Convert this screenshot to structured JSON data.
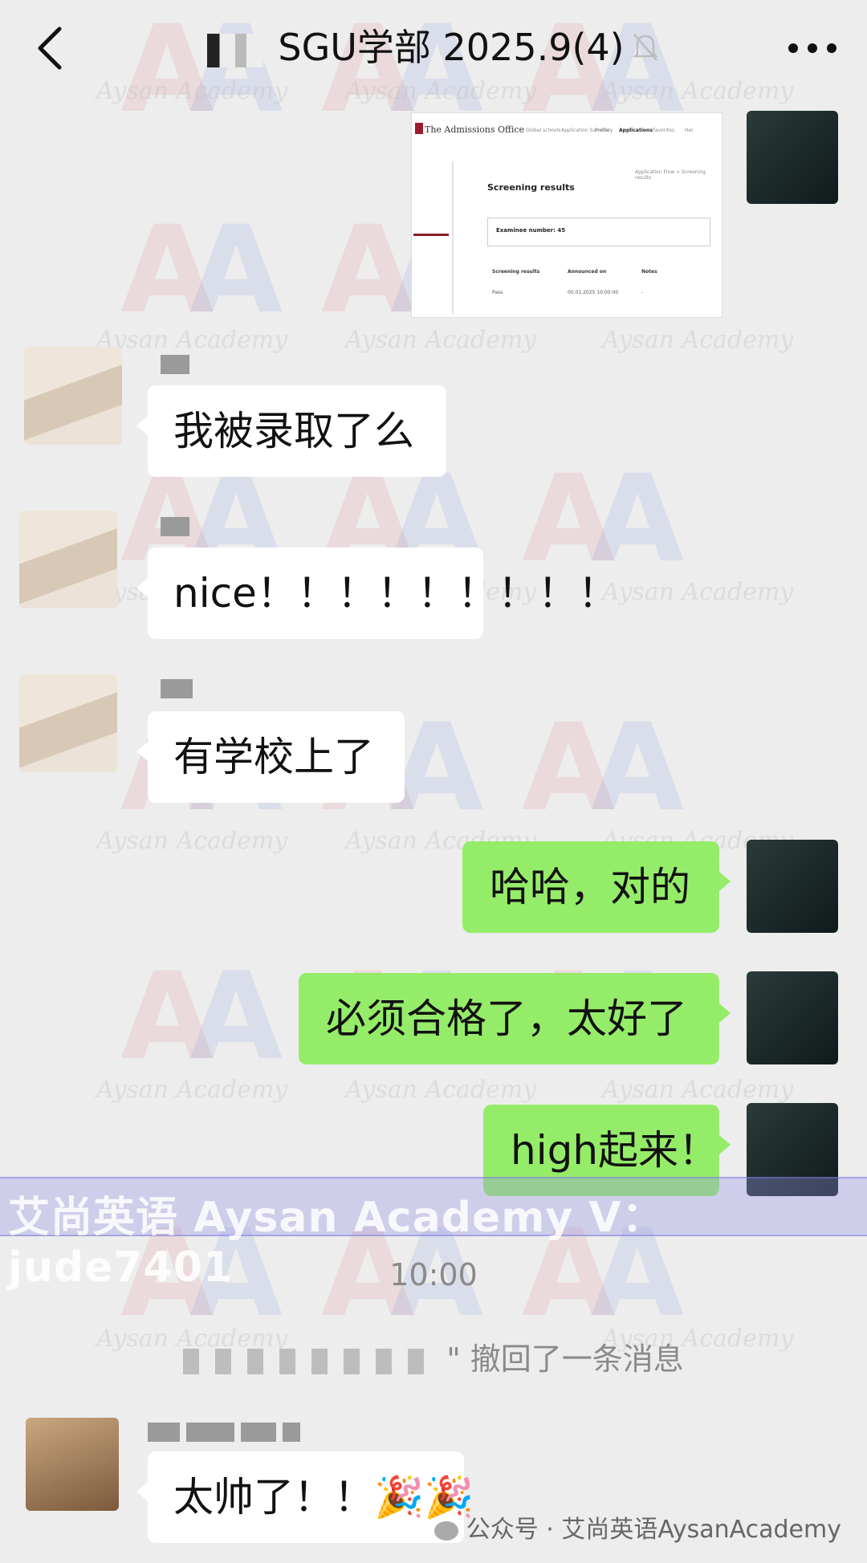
{
  "header": {
    "title": "SGU学部 2025.9(4)",
    "back_icon": "chevron-left-icon",
    "mute_icon": "bell-off-icon",
    "more_icon": "more-dots-icon"
  },
  "screenshot": {
    "logo": "The Admissions Office",
    "nav": [
      "Global schools",
      "Application Summary",
      "Profile",
      "Applications",
      "Favorites",
      "Hel"
    ],
    "breadcrumb_right": "Application Flow > Screening results",
    "heading": "Screening results",
    "examinee_label": "Examinee number: 45",
    "table_headers": [
      "Screening results",
      "Announced on",
      "Notes"
    ],
    "table_row": [
      "Pass",
      "00.01.2025 10:00:00",
      "-"
    ]
  },
  "messages": [
    {
      "side": "left",
      "text": "我被录取了么"
    },
    {
      "side": "left",
      "text": "nice！！！！！！！！！"
    },
    {
      "side": "left",
      "text": "有学校上了"
    },
    {
      "side": "right",
      "text": "哈哈，对的"
    },
    {
      "side": "right",
      "text": "必须合格了，太好了"
    },
    {
      "side": "right",
      "text": "high起来！"
    },
    {
      "side": "left",
      "text": "太帅了！！🎉🎉"
    }
  ],
  "banner": "艾尚英语 Aysan Academy V：jude7401",
  "time": "10:00",
  "recall_text": "\" 撤回了一条消息",
  "footer": "公众号 · 艾尚英语AysanAcademy",
  "watermark": "Aysan Academy",
  "colors": {
    "background": "#ededed",
    "bubble_right": "#95ec69",
    "bubble_left": "#ffffff"
  }
}
